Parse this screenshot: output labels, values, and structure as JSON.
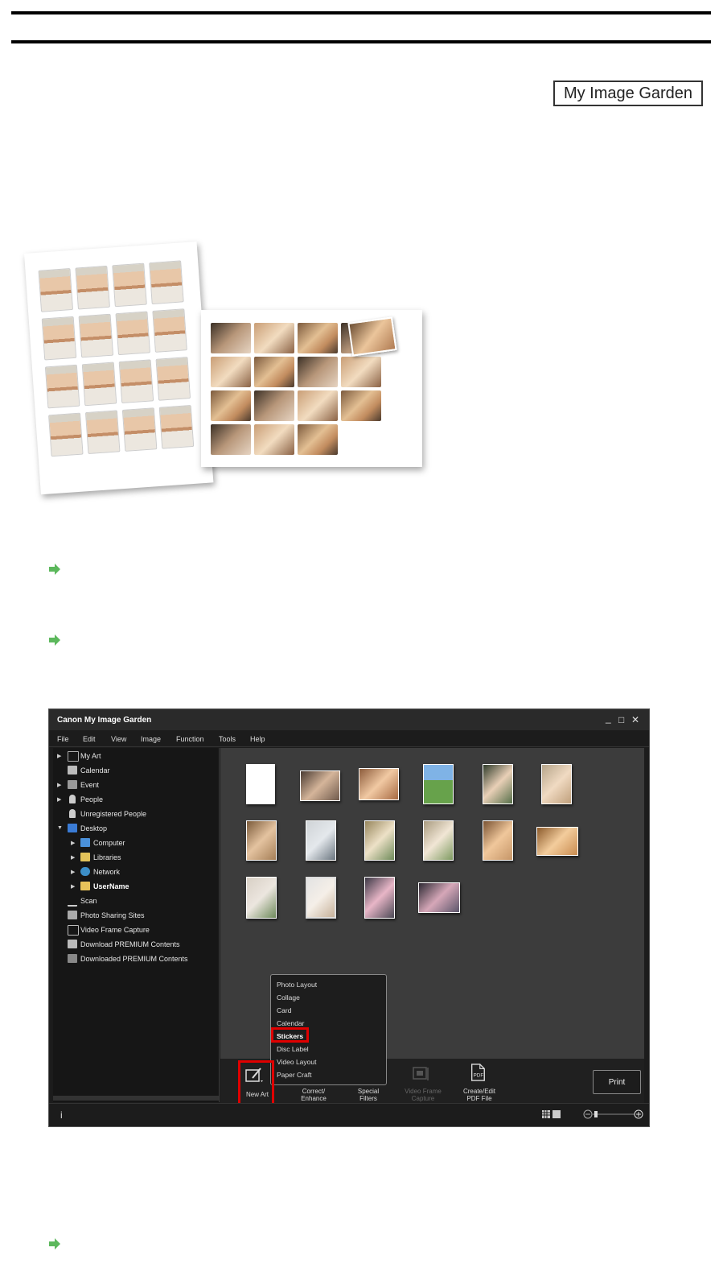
{
  "header": {
    "badge_label": "My Image Garden"
  },
  "app": {
    "title": "Canon My Image Garden",
    "window_controls": {
      "minimize": "_",
      "maximize": "□",
      "close": "✕"
    },
    "menu": [
      "File",
      "Edit",
      "View",
      "Image",
      "Function",
      "Tools",
      "Help"
    ],
    "sidebar": [
      {
        "label": "My Art",
        "icon": "my-art-icon"
      },
      {
        "label": "Calendar",
        "icon": "calendar-icon"
      },
      {
        "label": "Event",
        "icon": "event-icon"
      },
      {
        "label": "People",
        "icon": "people-icon"
      },
      {
        "label": "Unregistered People",
        "icon": "unregistered-people-icon"
      },
      {
        "label": "Desktop",
        "icon": "desktop-icon"
      },
      {
        "label": "Computer",
        "icon": "computer-icon"
      },
      {
        "label": "Libraries",
        "icon": "libraries-icon"
      },
      {
        "label": "Network",
        "icon": "network-icon"
      },
      {
        "label": "UserName",
        "icon": "user-folder-icon"
      },
      {
        "label": "Scan",
        "icon": "scan-icon"
      },
      {
        "label": "Photo Sharing Sites",
        "icon": "photo-sharing-icon"
      },
      {
        "label": "Video Frame Capture",
        "icon": "video-frame-icon"
      },
      {
        "label": "Download PREMIUM Contents",
        "icon": "download-premium-icon"
      },
      {
        "label": "Downloaded PREMIUM Contents",
        "icon": "downloaded-premium-icon"
      }
    ],
    "new_art_menu": [
      "Photo Layout",
      "Collage",
      "Card",
      "Calendar",
      "Stickers",
      "Disc Label",
      "Video Layout",
      "Paper Craft"
    ],
    "toolbar": {
      "new_art": "New Art",
      "correct_1": "Correct/",
      "correct_2": "Enhance",
      "special_1": "Special",
      "special_2": "Filters",
      "video_1": "Video Frame",
      "video_2": "Capture",
      "pdf_1": "Create/Edit",
      "pdf_2": "PDF File",
      "print": "Print"
    },
    "status": {
      "info": "i"
    },
    "colors": {
      "highlight": "#e00000",
      "arrow": "#5cb85c"
    }
  }
}
